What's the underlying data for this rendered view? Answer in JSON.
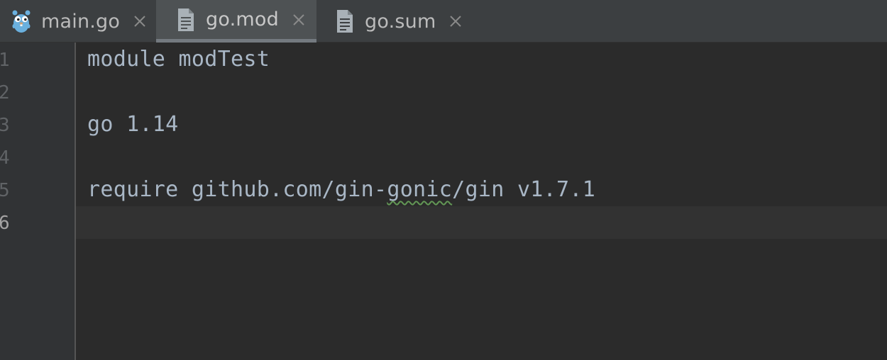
{
  "tabs": [
    {
      "label": "main.go",
      "icon": "gopher-icon",
      "active": false
    },
    {
      "label": "go.mod",
      "icon": "file-icon",
      "active": true
    },
    {
      "label": "go.sum",
      "icon": "file-icon",
      "active": false
    }
  ],
  "editor": {
    "current_line": 6,
    "lines": [
      {
        "number": "1",
        "pre": "module modTest",
        "squiggle": "",
        "post": ""
      },
      {
        "number": "2",
        "pre": "",
        "squiggle": "",
        "post": ""
      },
      {
        "number": "3",
        "pre": "go 1.14",
        "squiggle": "",
        "post": ""
      },
      {
        "number": "4",
        "pre": "",
        "squiggle": "",
        "post": ""
      },
      {
        "number": "5",
        "pre": "require github.com/gin-",
        "squiggle": "gonic",
        "post": "/gin v1.7.1"
      },
      {
        "number": "6",
        "pre": "",
        "squiggle": "",
        "post": ""
      }
    ]
  },
  "colors": {
    "background": "#2b2b2b",
    "tab_bar": "#3c3f41",
    "gutter": "#313335",
    "code_text": "#a9b7c6",
    "squiggle": "#629755"
  }
}
